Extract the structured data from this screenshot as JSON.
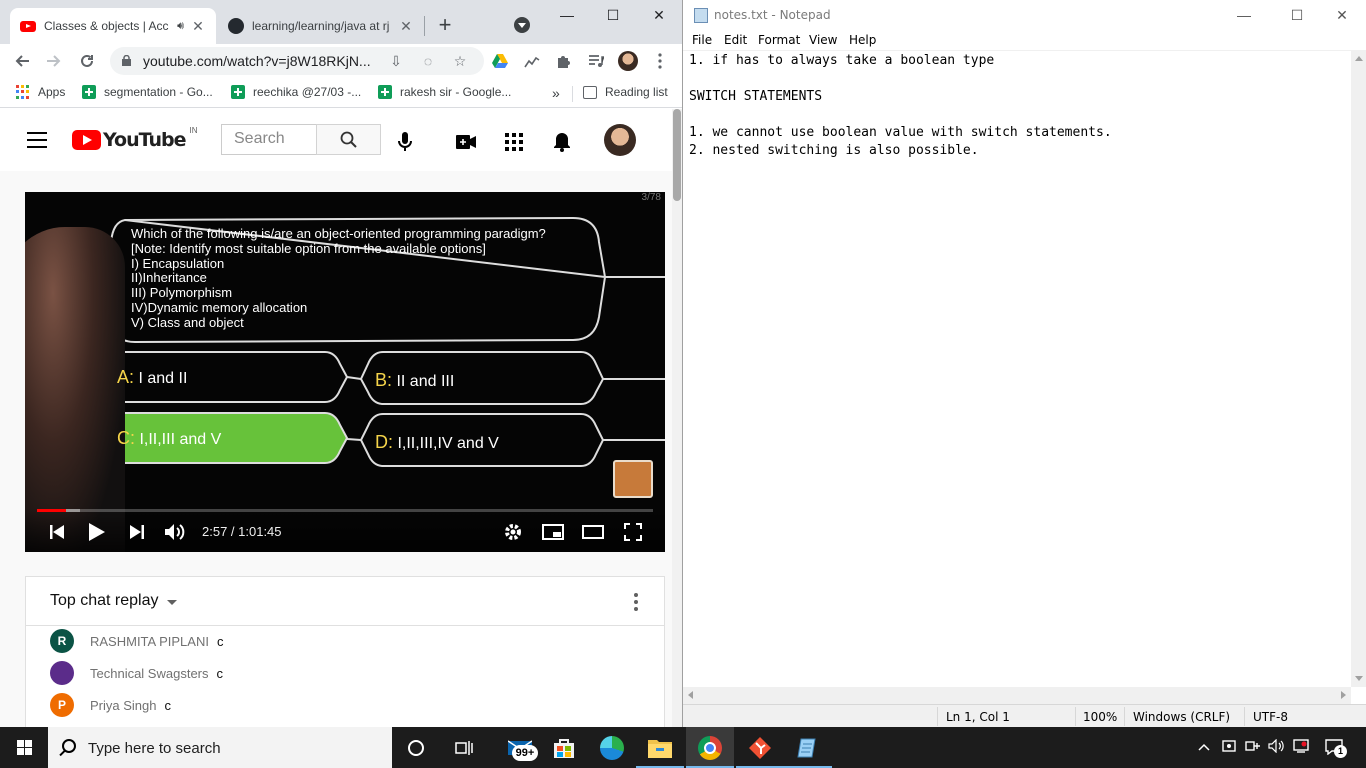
{
  "chrome": {
    "tabs": [
      {
        "title": "Classes & objects | Acc",
        "active": true,
        "icon": "youtube-icon"
      },
      {
        "title": "learning/learning/java at rj",
        "active": false,
        "icon": "github-icon"
      }
    ],
    "url": "youtube.com/watch?v=j8W18RKjN...",
    "bookmarks": [
      {
        "label": "Apps",
        "icon": "apps-grid-icon"
      },
      {
        "label": "segmentation - Go...",
        "icon": "sheets-icon"
      },
      {
        "label": "reechika @27/03 -...",
        "icon": "sheets-icon"
      },
      {
        "label": "rakesh sir - Google...",
        "icon": "sheets-icon"
      }
    ],
    "reading_list": "Reading list",
    "more_bookmarks": "»"
  },
  "youtube": {
    "logo_text": "YouTube",
    "country_code": "IN",
    "search_placeholder": "Search",
    "video": {
      "slide_number": "3/78",
      "question": "Which of the following is/are an object-oriented programming paradigm?\n[Note: Identify most suitable option from the available options]\nI) Encapsulation\nII)Inheritance\nIII) Polymorphism\nIV)Dynamic memory allocation\nV) Class and object",
      "options": [
        {
          "key": "A:",
          "text": "I and II",
          "correct": false
        },
        {
          "key": "B:",
          "text": "II and III",
          "correct": false
        },
        {
          "key": "C:",
          "text": "I,II,III and V",
          "correct": true
        },
        {
          "key": "D:",
          "text": "I,II,III,IV and V",
          "correct": false
        }
      ],
      "time": "2:57 / 1:01:45",
      "progress_played": 0.047,
      "progress_loaded": 0.07
    },
    "chat": {
      "title": "Top chat replay",
      "messages": [
        {
          "initial": "R",
          "author": "RASHMITA PIPLANI",
          "text": "c",
          "color": "#0b5345"
        },
        {
          "initial": "",
          "author": "Technical Swagsters",
          "text": "c",
          "color": "#5b2c8a"
        },
        {
          "initial": "P",
          "author": "Priya Singh",
          "text": "c",
          "color": "#ef6c00"
        }
      ]
    }
  },
  "notepad": {
    "title": "notes.txt - Notepad",
    "menu": [
      "File",
      "Edit",
      "Format",
      "View",
      "Help"
    ],
    "lines": [
      "1. if has to always take a boolean type",
      "",
      "SWITCH STATEMENTS",
      "",
      "1. we cannot use boolean value with switch statements.",
      "2. nested switching is also possible."
    ],
    "status": {
      "position": "Ln 1, Col 1",
      "zoom": "100%",
      "line_ending": "Windows (CRLF)",
      "encoding": "UTF-8"
    }
  },
  "taskbar": {
    "search_placeholder": "Type here to search",
    "mail_badge": "99+",
    "notification_count": "1"
  }
}
